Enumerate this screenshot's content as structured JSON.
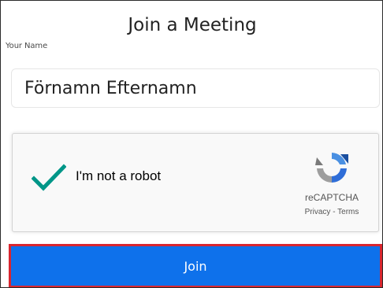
{
  "header": {
    "title": "Join a Meeting"
  },
  "name_field": {
    "label": "Your Name",
    "value": "Förnamn Efternamn"
  },
  "recaptcha": {
    "checkbox_label": "I'm not a robot",
    "checked": true,
    "check_color": "#009688",
    "icon": "recaptcha-logo-icon",
    "brand": "reCAPTCHA",
    "privacy_label": "Privacy",
    "separator": " - ",
    "terms_label": "Terms"
  },
  "actions": {
    "join_label": "Join",
    "join_color": "#0e71eb",
    "focus_outline_color": "#d9262f"
  }
}
